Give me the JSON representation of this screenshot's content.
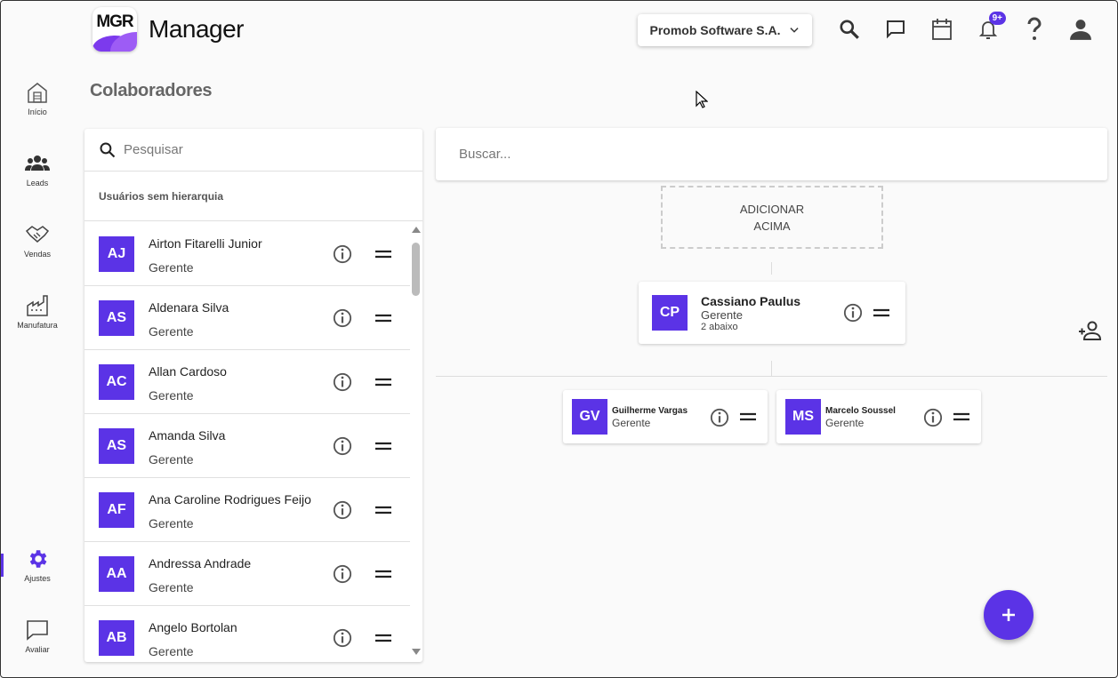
{
  "app": {
    "logo_text": "MGR",
    "title": "Manager"
  },
  "header": {
    "company": "Promob Software S.A.",
    "notifications_badge": "9+",
    "icons": [
      "search-icon",
      "chat-icon",
      "calendar-icon",
      "bell-icon",
      "help-icon",
      "account-icon"
    ]
  },
  "sidebar": {
    "items": [
      {
        "label": "Início",
        "icon": "home-icon"
      },
      {
        "label": "Leads",
        "icon": "people-icon"
      },
      {
        "label": "Vendas",
        "icon": "handshake-icon"
      },
      {
        "label": "Manufatura",
        "icon": "factory-icon"
      },
      {
        "label": "Ajustes",
        "icon": "gear-icon",
        "active": true
      },
      {
        "label": "Avaliar",
        "icon": "feedback-icon"
      }
    ]
  },
  "page": {
    "title": "Colaboradores"
  },
  "left_panel": {
    "search_placeholder": "Pesquisar",
    "section_label": "Usuários sem hierarquia",
    "users": [
      {
        "initials": "AJ",
        "name": "Airton Fitarelli Junior",
        "role": "Gerente"
      },
      {
        "initials": "AS",
        "name": "Aldenara Silva",
        "role": "Gerente"
      },
      {
        "initials": "AC",
        "name": "Allan Cardoso",
        "role": "Gerente"
      },
      {
        "initials": "AS",
        "name": "Amanda Silva",
        "role": "Gerente"
      },
      {
        "initials": "AF",
        "name": "Ana Caroline Rodrigues Feijo",
        "role": "Gerente"
      },
      {
        "initials": "AA",
        "name": "Andressa Andrade",
        "role": "Gerente"
      },
      {
        "initials": "AB",
        "name": "Angelo Bortolan",
        "role": "Gerente"
      }
    ]
  },
  "right_panel": {
    "search_placeholder": "Buscar...",
    "add_above_line1": "ADICIONAR",
    "add_above_line2": "ACIMA",
    "root": {
      "initials": "CP",
      "name": "Cassiano Paulus",
      "role": "Gerente",
      "below": "2 abaixo"
    },
    "children": [
      {
        "initials": "GV",
        "name": "Guilherme Vargas",
        "role": "Gerente"
      },
      {
        "initials": "MS",
        "name": "Marcelo Soussel",
        "role": "Gerente"
      }
    ]
  },
  "colors": {
    "accent": "#5b33e6"
  }
}
